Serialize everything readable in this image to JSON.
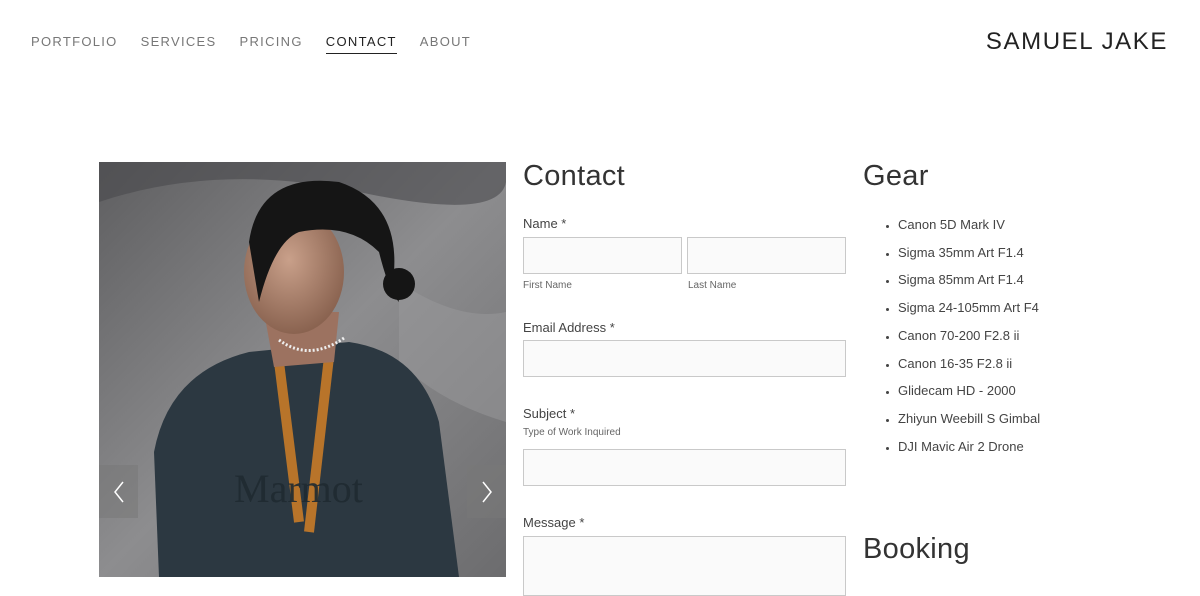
{
  "nav": {
    "items": [
      {
        "label": "PORTFOLIO"
      },
      {
        "label": "SERVICES"
      },
      {
        "label": "PRICING"
      },
      {
        "label": "CONTACT"
      },
      {
        "label": "ABOUT"
      }
    ],
    "active": "CONTACT"
  },
  "brand": "SAMUEL JAKE",
  "slideshow": {
    "prev_icon": "chevron-left-icon",
    "next_icon": "chevron-right-icon"
  },
  "contact": {
    "title": "Contact",
    "name_label": "Name *",
    "first_name_caption": "First Name",
    "last_name_caption": "Last Name",
    "email_label": "Email Address *",
    "subject_label": "Subject *",
    "subject_hint": "Type of Work Inquired",
    "message_label": "Message *"
  },
  "gear": {
    "title": "Gear",
    "items": [
      "Canon 5D Mark IV",
      "Sigma 35mm Art F1.4",
      "Sigma 85mm Art F1.4",
      "Sigma 24-105mm Art F4",
      "Canon 70-200 F2.8 ii",
      "Canon 16-35 F2.8 ii",
      "Glidecam HD - 2000",
      "Zhiyun Weebill S Gimbal",
      "DJI Mavic Air 2 Drone"
    ]
  },
  "booking": {
    "title": "Booking"
  },
  "colors": {
    "text": "#333333",
    "nav": "#777777",
    "input_border": "#c9c9c9",
    "input_bg": "#fafafa"
  }
}
